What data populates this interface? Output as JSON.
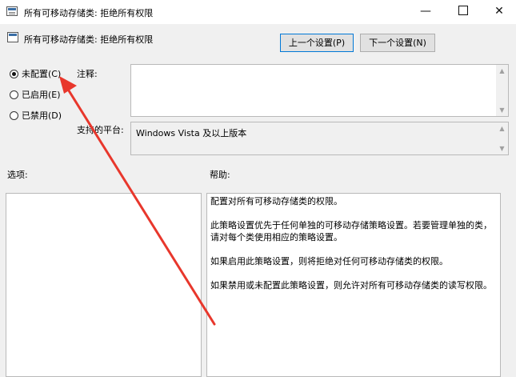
{
  "window": {
    "title": "所有可移动存储类: 拒绝所有权限",
    "minimize_glyph": "—",
    "close_glyph": "✕"
  },
  "header": {
    "title": "所有可移动存储类: 拒绝所有权限",
    "prev_label": "上一个设置(P)",
    "next_label": "下一个设置(N)"
  },
  "radios": [
    {
      "label": "未配置(C)",
      "checked": true
    },
    {
      "label": "已启用(E)",
      "checked": false
    },
    {
      "label": "已禁用(D)",
      "checked": false
    }
  ],
  "labels": {
    "comment": "注释:",
    "platform": "支持的平台:",
    "options": "选项:",
    "help": "帮助:"
  },
  "comment_value": "",
  "platform_value": "Windows Vista 及以上版本",
  "help_paragraphs": [
    "配置对所有可移动存储类的权限。",
    "此策略设置优先于任何单独的可移动存储策略设置。若要管理单独的类，",
    "请对每个类使用相应的策略设置。",
    "如果启用此策略设置，则将拒绝对任何可移动存储类的权限。",
    "如果禁用或未配置此策略设置，则允许对所有可移动存储类的读写权限。"
  ],
  "scroll": {
    "up_glyph": "▲",
    "down_glyph": "▼"
  },
  "colors": {
    "annotation_arrow": "#e8372c",
    "accent_border": "#0078d7"
  }
}
